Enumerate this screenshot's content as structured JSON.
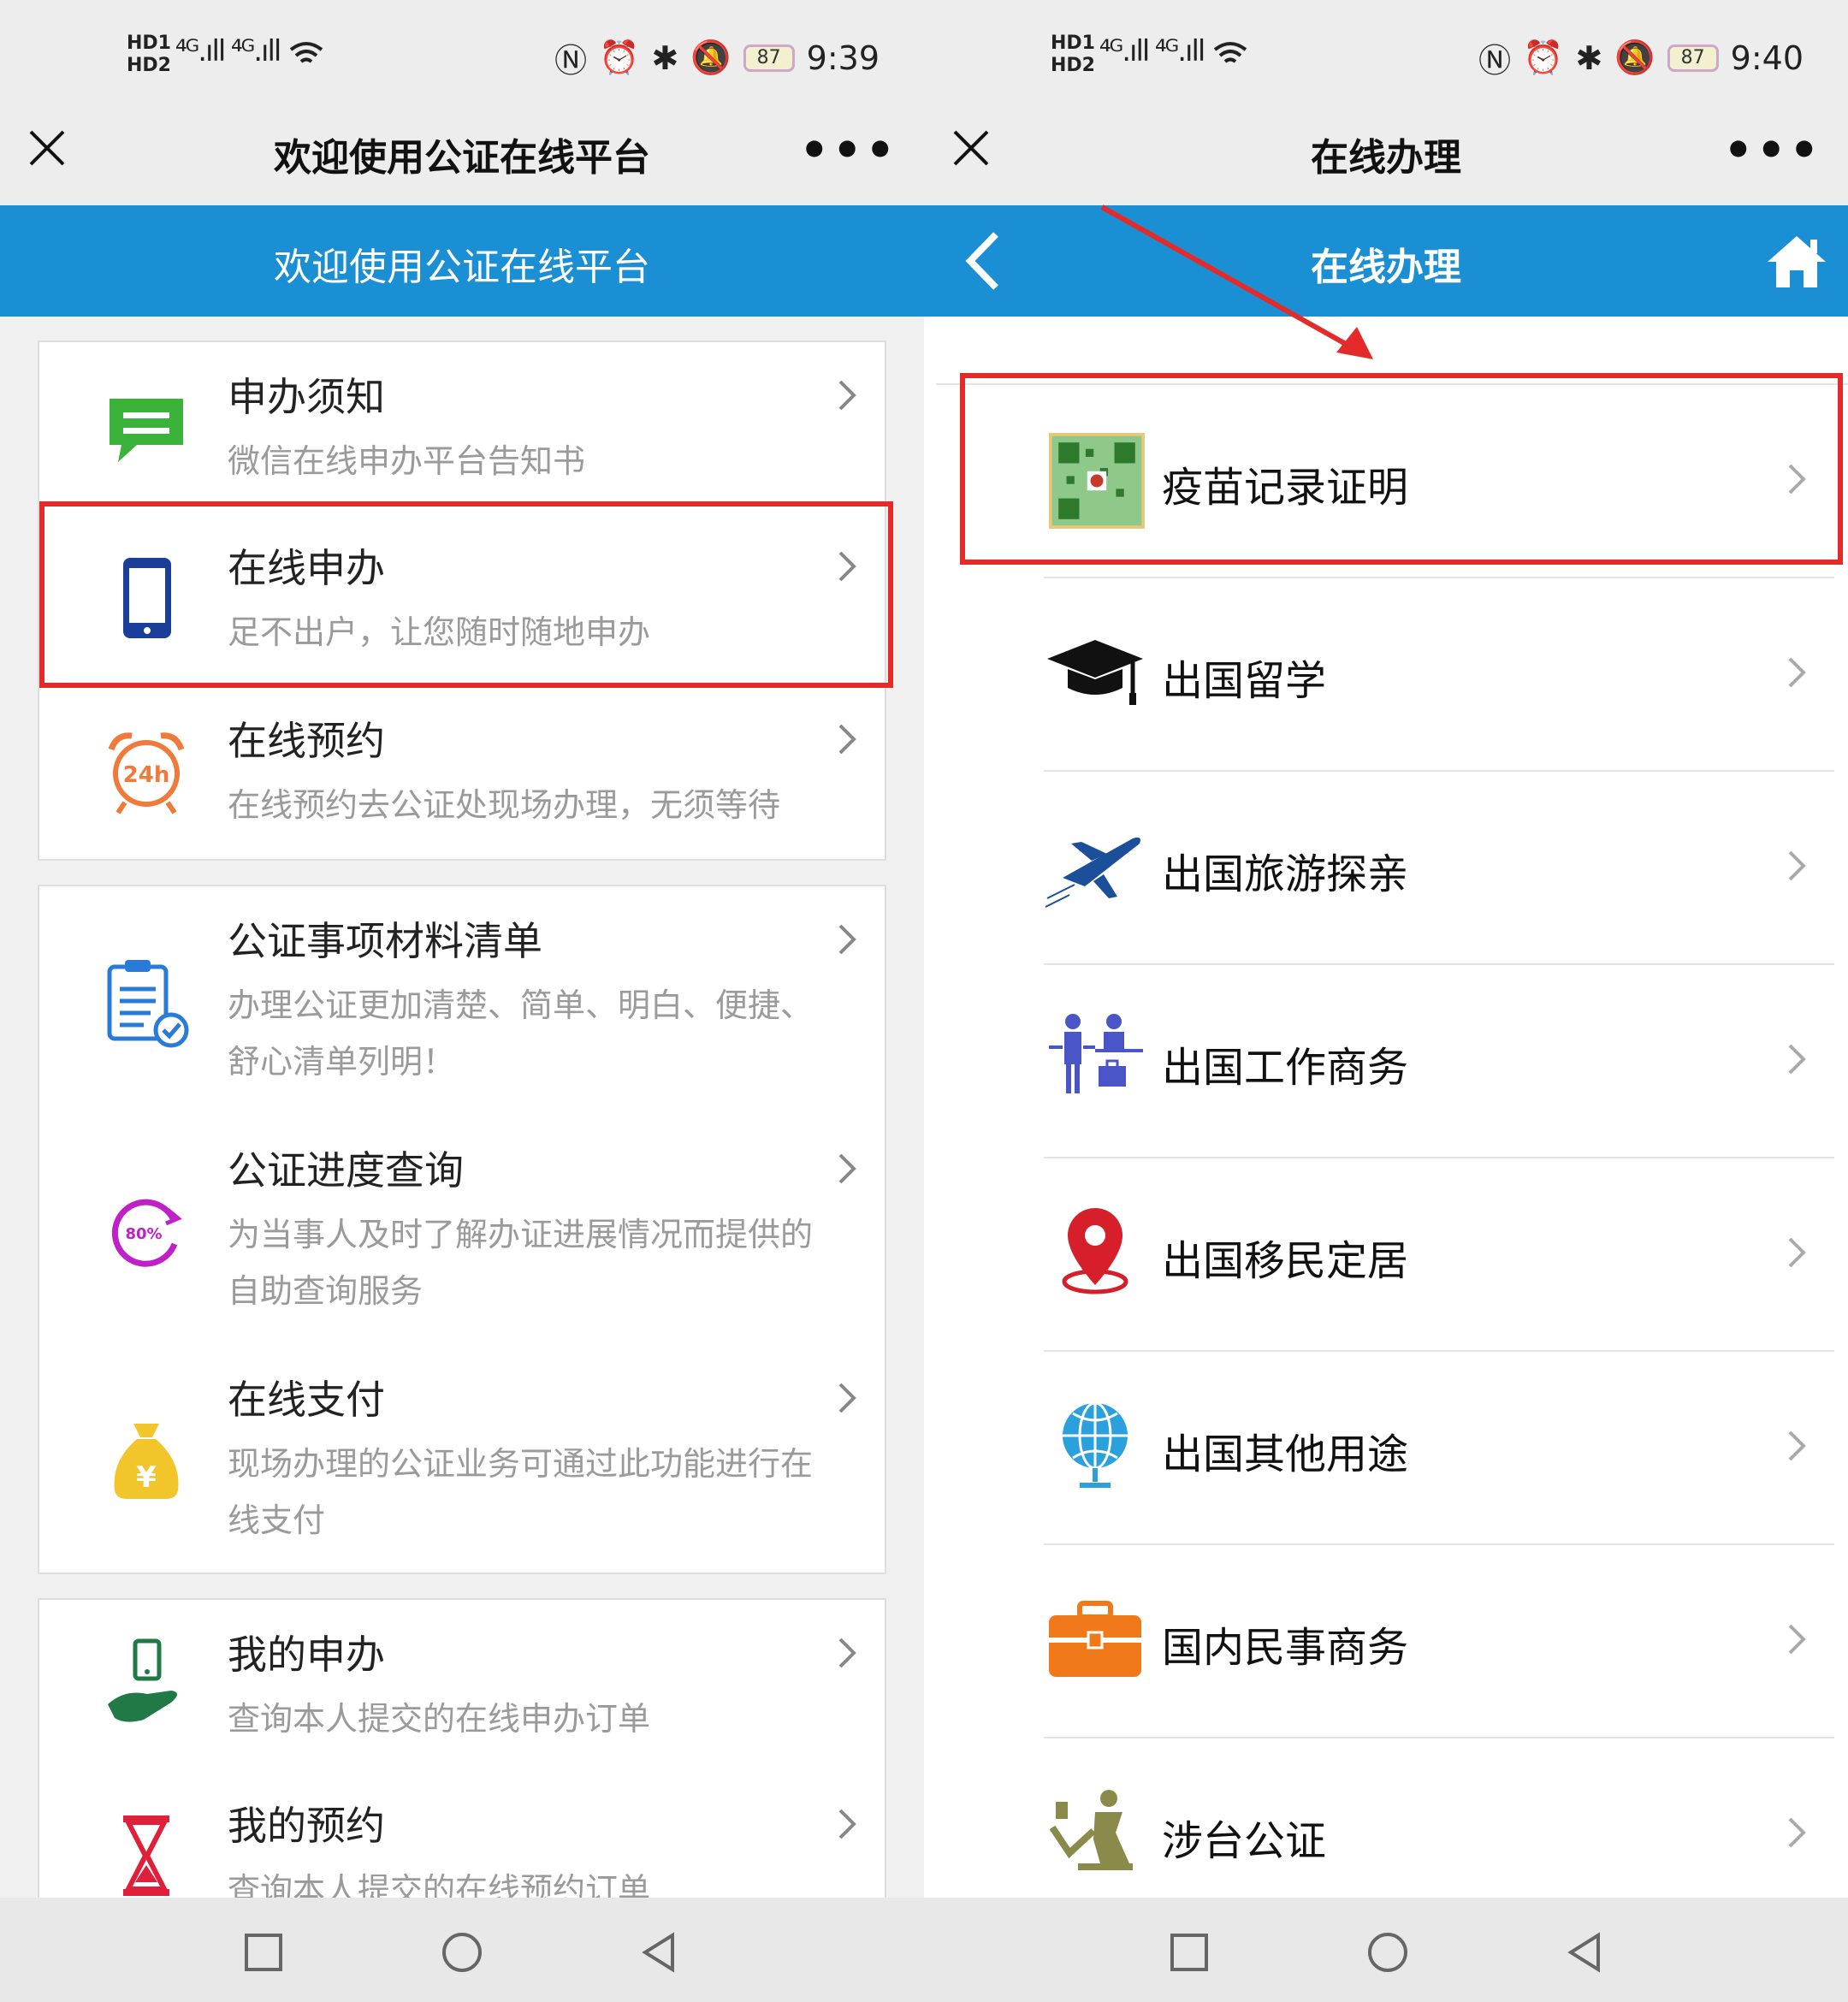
{
  "left": {
    "status": {
      "hd1": "HD1",
      "hd2": "HD2",
      "sig1": "⁴ᴳ.ıll",
      "sig2": "⁴ᴳ.ıll",
      "battery": "87",
      "time": "9:39"
    },
    "window_title": "欢迎使用公证在线平台",
    "header_title": "欢迎使用公证在线平台",
    "items": [
      {
        "title": "申办须知",
        "desc": "微信在线申办平台告知书",
        "icon": "message-icon",
        "color": "#3bb33b"
      },
      {
        "title": "在线申办",
        "desc": "足不出户，让您随时随地申办",
        "icon": "phone-icon",
        "color": "#1a3e9a"
      },
      {
        "title": "在线预约",
        "desc": "在线预约去公证处现场办理，无须等待",
        "icon": "alarm-clock-icon",
        "color": "#f07a3a",
        "icon_text": "24h"
      },
      {
        "title": "公证事项材料清单",
        "desc": "办理公证更加清楚、简单、明白、便捷、舒心清单列明！",
        "icon": "clipboard-check-icon",
        "color": "#2a7ad8"
      },
      {
        "title": "公证进度查询",
        "desc": "为当事人及时了解办证进展情况而提供的自助查询服务",
        "icon": "progress-ring-icon",
        "color": "#c020c8",
        "icon_text": "80%"
      },
      {
        "title": "在线支付",
        "desc": "现场办理的公证业务可通过此功能进行在线支付",
        "icon": "money-bag-icon",
        "color": "#f2c52a",
        "icon_text": "¥"
      },
      {
        "title": "我的申办",
        "desc": "查询本人提交的在线申办订单",
        "icon": "hand-phone-icon",
        "color": "#1f7a45"
      },
      {
        "title": "我的预约",
        "desc": "查询本人提交的在线预约订单",
        "icon": "hourglass-icon",
        "color": "#e0203a"
      }
    ]
  },
  "right": {
    "status": {
      "hd1": "HD1",
      "hd2": "HD2",
      "sig1": "⁴ᴳ.ıll",
      "sig2": "⁴ᴳ.ıll",
      "battery": "87",
      "time": "9:40"
    },
    "window_title": "在线办理",
    "header_title": "在线办理",
    "items": [
      {
        "label": "疫苗记录证明",
        "icon": "qr-code-icon"
      },
      {
        "label": "出国留学",
        "icon": "graduation-cap-icon"
      },
      {
        "label": "出国旅游探亲",
        "icon": "airplane-icon"
      },
      {
        "label": "出国工作商务",
        "icon": "business-people-icon"
      },
      {
        "label": "出国移民定居",
        "icon": "map-pin-icon"
      },
      {
        "label": "出国其他用途",
        "icon": "globe-icon"
      },
      {
        "label": "国内民事商务",
        "icon": "briefcase-icon"
      },
      {
        "label": "涉台公证",
        "icon": "stamp-icon"
      }
    ]
  },
  "colors": {
    "header_blue": "#1a8fd3",
    "highlight_red": "#e52a2a"
  }
}
